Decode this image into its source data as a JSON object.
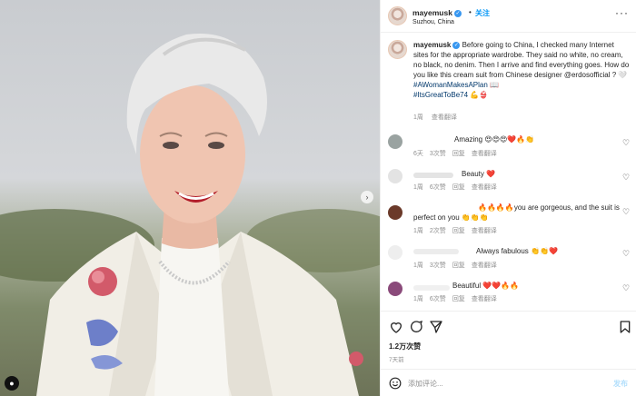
{
  "header": {
    "username": "mayemusk",
    "verified_mark": "✓",
    "separator": "•",
    "follow_label": "关注",
    "location": "Suzhou, China",
    "more_icon": "more-icon"
  },
  "caption": {
    "username": "mayemusk",
    "text": "Before going to China, I checked many Internet sites for the appropriate wardrobe. They said no white, no cream, no black, no denim. Then I arrive and find everything goes. How do you like this cream suit from Chinese designer @erdosofficial ? 🤍",
    "hashtags": [
      "#AWomanMakesAPlan 📖",
      "#ItsGreatToBe74 💪👙"
    ],
    "time": "1周",
    "translate": "查看翻译"
  },
  "comments": [
    {
      "text": "Amazing 😍😍😍❤️🔥👏",
      "time": "6天",
      "likes": "3次赞",
      "reply": "回复",
      "translate": "查看翻译",
      "avatar_color": "#9aa3a1"
    },
    {
      "text": "Beauty ❤️",
      "time": "1周",
      "likes": "6次赞",
      "reply": "回复",
      "translate": "查看翻译",
      "avatar_color": "#e3e3e3"
    },
    {
      "text_line1": "🔥🔥🔥🔥you are gorgeous, and the suit is",
      "text_line2": "perfect on you 👏👏👏",
      "time": "1周",
      "likes": "2次赞",
      "reply": "回复",
      "translate": "查看翻译",
      "avatar_color": "#6b3a2a"
    },
    {
      "text": "Always fabulous 👏👏❤️",
      "time": "1周",
      "likes": "3次赞",
      "reply": "回复",
      "translate": "查看翻译",
      "avatar_color": "#eeeeee"
    },
    {
      "text": "Beautiful ❤️❤️🔥🔥",
      "time": "1周",
      "likes": "6次赞",
      "reply": "回复",
      "translate": "查看翻译",
      "avatar_color": "#8a4a7a"
    }
  ],
  "actions": {
    "likes": "1.2万次赞",
    "posted": "7天前"
  },
  "comment_box": {
    "placeholder": "添加评论...",
    "post_label": "发布"
  },
  "photo": {
    "next_icon": "›",
    "user_icon": "●"
  },
  "colors": {
    "accent": "#0095f6",
    "verified": "#3897f0",
    "link": "#00376b",
    "muted": "#8e8e8e"
  }
}
